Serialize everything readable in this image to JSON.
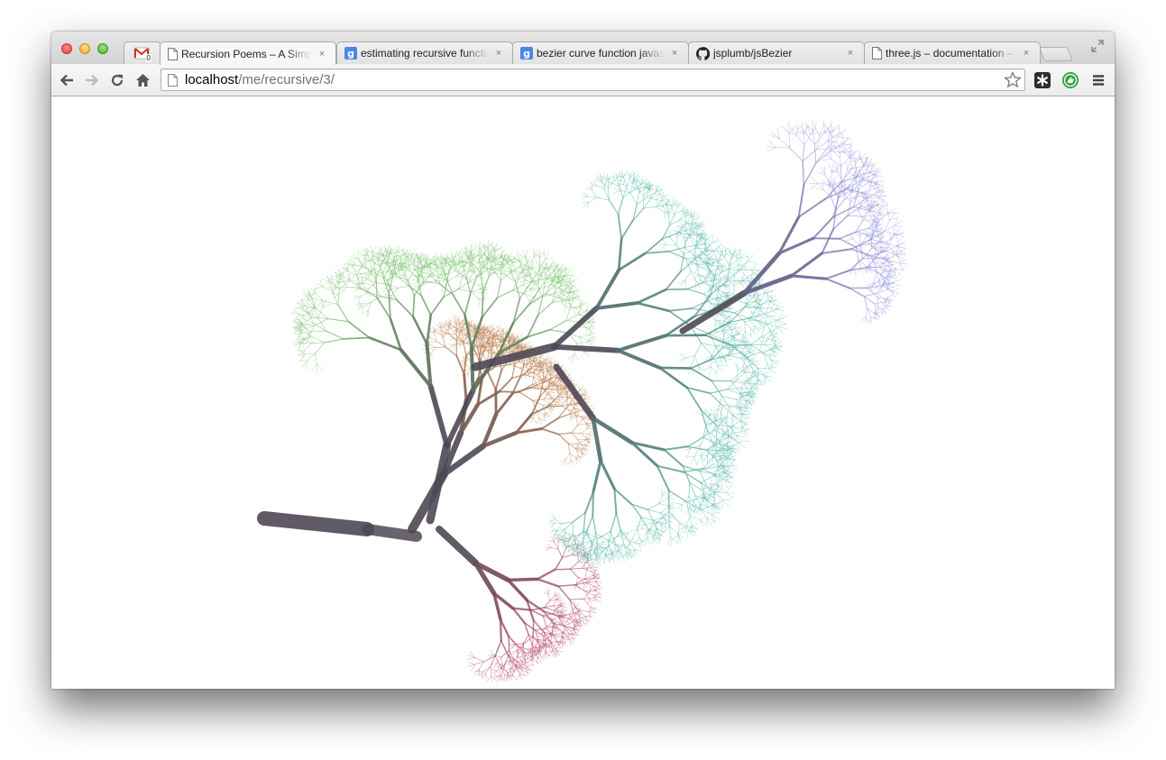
{
  "window": {
    "tabs": [
      {
        "icon": "gmail-icon",
        "title": "",
        "close": ""
      },
      {
        "icon": "page-icon",
        "title": "Recursion Poems – A Simple Generator",
        "close": "×"
      },
      {
        "icon": "google-icon",
        "title": "estimating recursive function calls",
        "close": "×"
      },
      {
        "icon": "google-icon",
        "title": "bezier curve function javascript",
        "close": "×"
      },
      {
        "icon": "github-icon",
        "title": "jsplumb/jsBezier",
        "close": "×"
      },
      {
        "icon": "page-icon",
        "title": "three.js – documentation – Reference",
        "close": "×"
      }
    ],
    "gmail_unread": "0",
    "google_favicon_letter": "g"
  },
  "toolbar": {
    "back_icon": "arrow-left-icon",
    "forward_icon": "arrow-right-icon",
    "reload_icon": "reload-icon",
    "home_icon": "home-icon",
    "url_host": "localhost",
    "url_path": "/me/recursive/3/",
    "bookmark_icon": "star-icon",
    "extensions": [
      "asterisk-extension-icon",
      "thumbs-up-extension-icon"
    ],
    "menu_icon": "hamburger-menu-icon"
  },
  "canvas": {
    "content": "recursive-tree-fractal",
    "colors": {
      "trunk": "#4e4855",
      "lower": "#b24a6a",
      "left": "#b87a4a",
      "top": "#6fbe62",
      "right": "#55b8a4",
      "far": "#8a88d6"
    }
  }
}
